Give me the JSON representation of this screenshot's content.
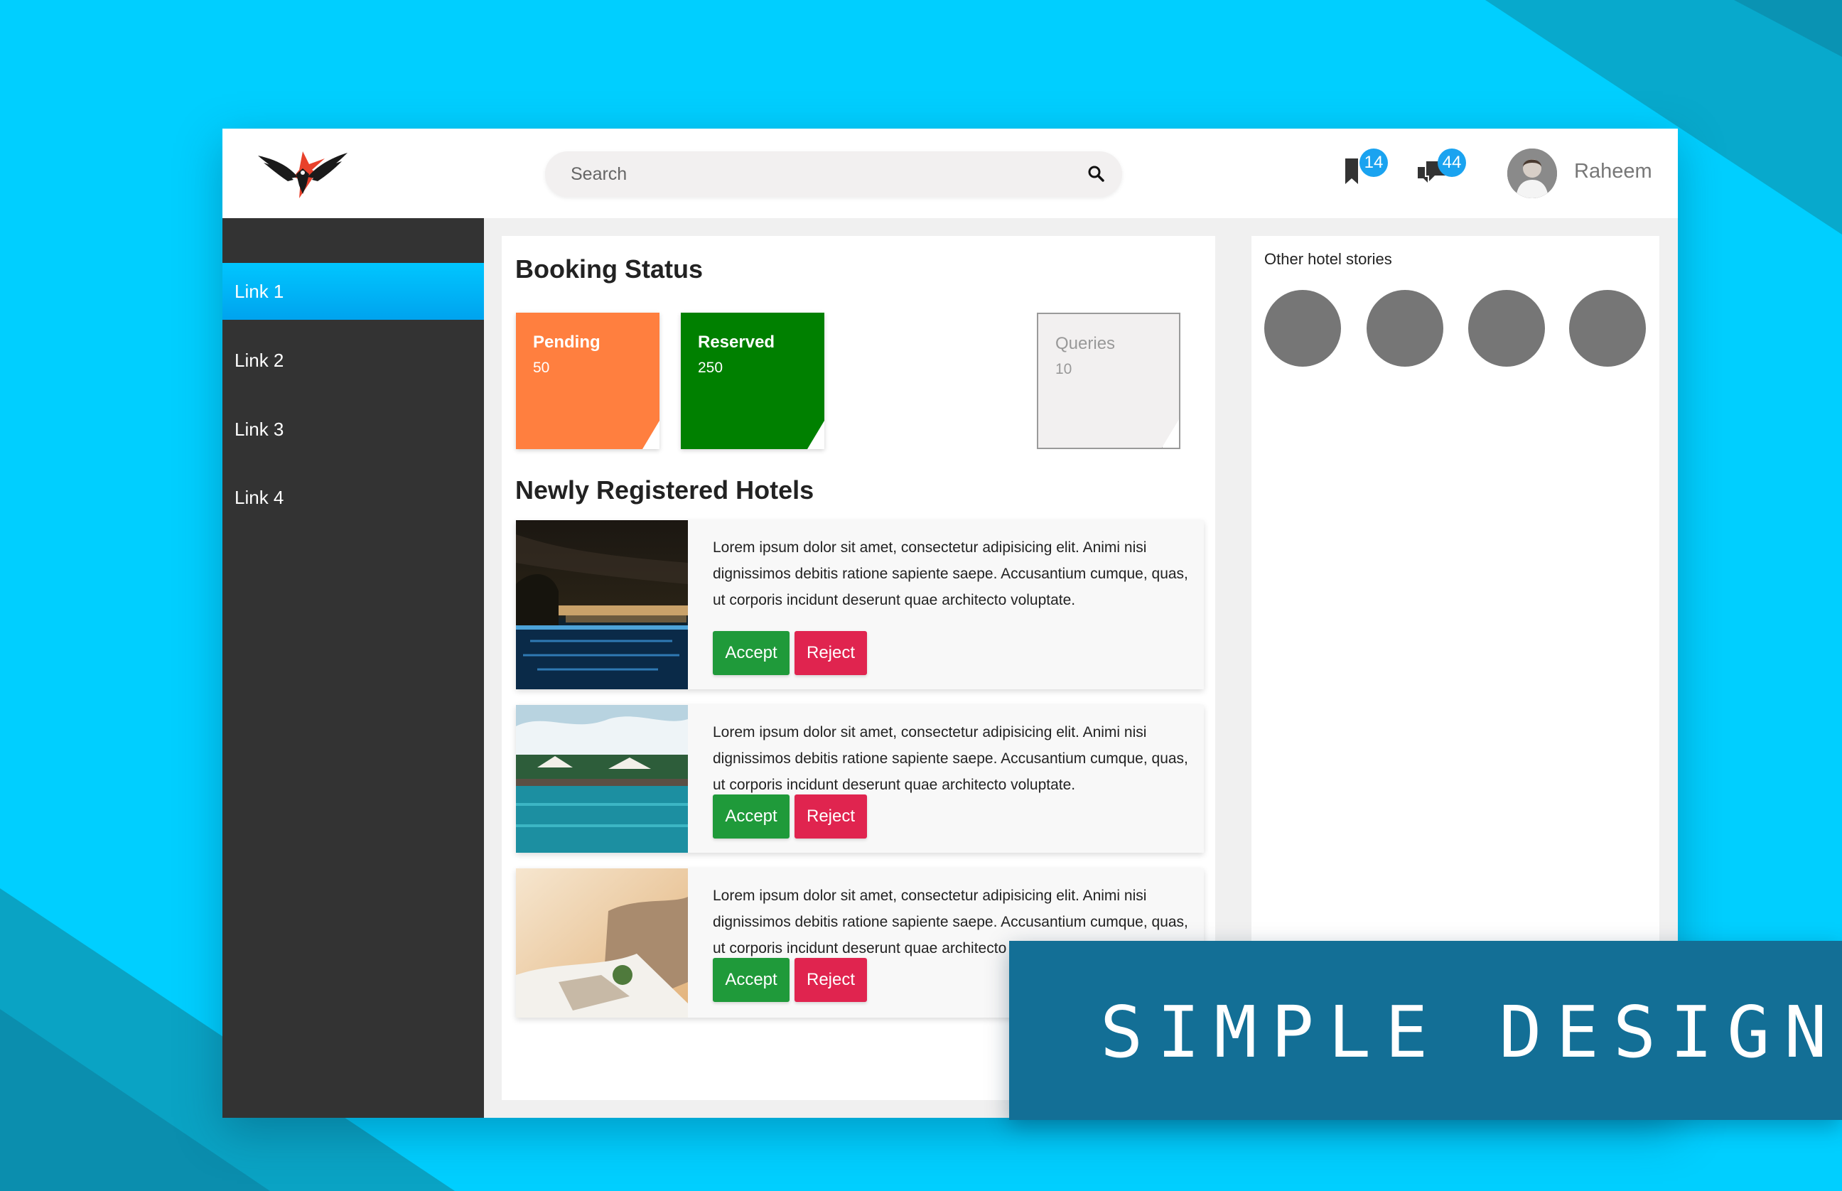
{
  "header": {
    "search_placeholder": "Search",
    "bookmark_count": "14",
    "message_count": "44",
    "user_name": "Raheem"
  },
  "sidebar": {
    "items": [
      {
        "label": "Link 1",
        "active": true
      },
      {
        "label": "Link 2",
        "active": false
      },
      {
        "label": "Link 3",
        "active": false
      },
      {
        "label": "Link 4",
        "active": false
      }
    ]
  },
  "booking": {
    "title": "Booking Status",
    "cards": [
      {
        "label": "Pending",
        "value": "50",
        "color": "#ff7f3f"
      },
      {
        "label": "Reserved",
        "value": "250",
        "color": "#008000"
      },
      {
        "label": "Queries",
        "value": "10",
        "color": "#f2f0f0"
      }
    ]
  },
  "hotels": {
    "title": "Newly Registered Hotels",
    "items": [
      {
        "description": "Lorem ipsum dolor sit amet, consectetur adipisicing elit. Animi nisi dignissimos debitis ratione sapiente saepe. Accusantium cumque, quas, ut corporis incidunt deserunt quae architecto voluptate.",
        "accept_label": "Accept",
        "reject_label": "Reject"
      },
      {
        "description": "Lorem ipsum dolor sit amet, consectetur adipisicing elit. Animi nisi dignissimos debitis ratione sapiente saepe. Accusantium cumque, quas, ut corporis incidunt deserunt quae architecto voluptate.",
        "accept_label": "Accept",
        "reject_label": "Reject"
      },
      {
        "description": "Lorem ipsum dolor sit amet, consectetur adipisicing elit. Animi nisi dignissimos debitis ratione sapiente saepe. Accusantium cumque, quas, ut corporis incidunt deserunt quae architecto voluptate.",
        "accept_label": "Accept",
        "reject_label": "Reject"
      }
    ]
  },
  "stories": {
    "title": "Other hotel stories"
  },
  "banner": {
    "text": "SIMPLE DESIGN"
  },
  "colors": {
    "accent": "#00b4f5",
    "sidebar_bg": "#333333",
    "accept": "#1f9a3a",
    "reject": "#e0244f",
    "banner": "#136f96"
  }
}
